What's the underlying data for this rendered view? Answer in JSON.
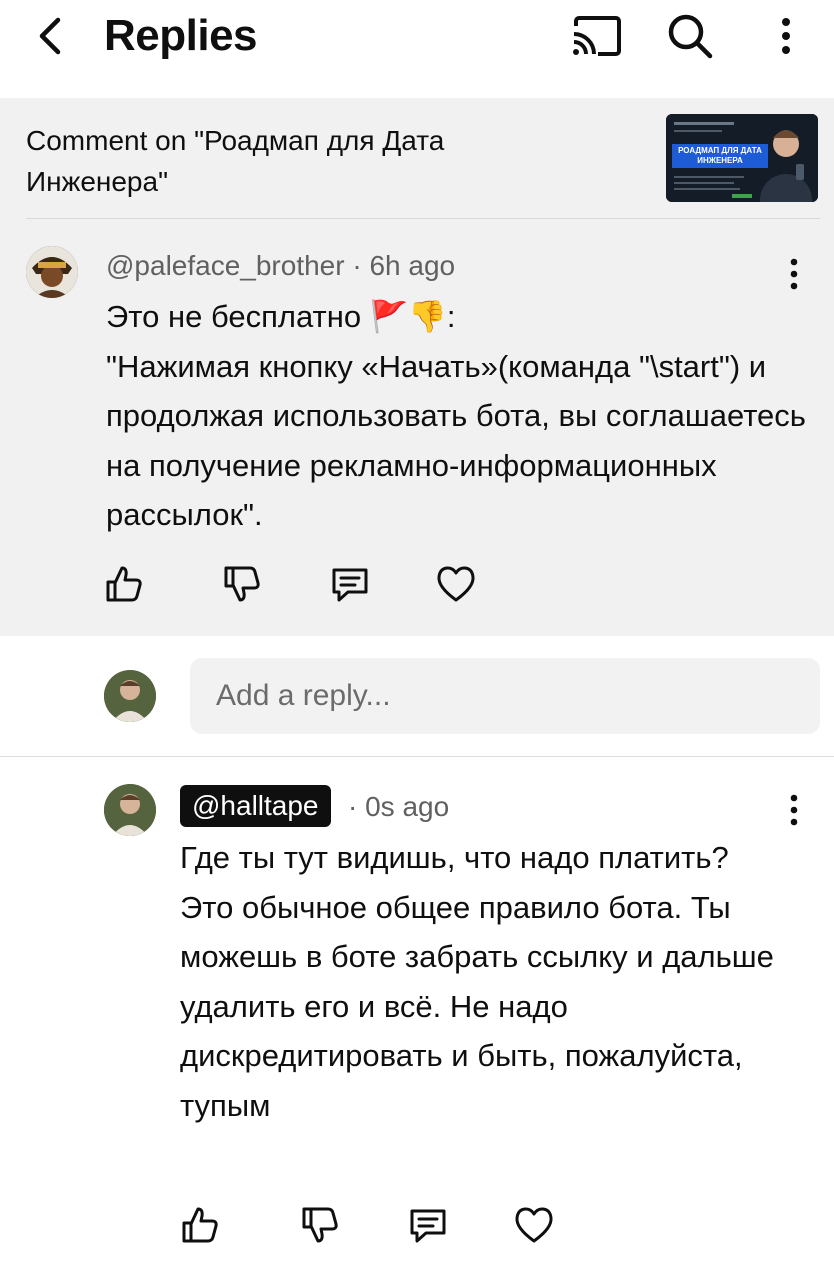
{
  "header": {
    "title": "Replies",
    "icons": [
      "back-arrow-icon",
      "cast-icon",
      "search-icon",
      "more-vert-icon"
    ]
  },
  "context": {
    "label": "Comment on \"Роадмап для Дата Инженера\"",
    "thumbnail_title": "РОАДМАП ДЛЯ ДАТА ИНЖЕНЕРА"
  },
  "comment": {
    "author": "@paleface_brother",
    "time": "6h ago",
    "text_line1": "Это не бесплатно 🚩👎:",
    "text_rest": "\"Нажимая кнопку «Начать»(команда \"\\start\") и продолжая использовать бота, вы соглашаетесь на получение рекламно-информационных рассылок\".",
    "actions": [
      "like-icon",
      "dislike-icon",
      "reply-icon",
      "heart-icon"
    ]
  },
  "reply_box": {
    "placeholder": "Add a reply..."
  },
  "reply": {
    "author": "@halltape",
    "time": "0s ago",
    "text": "Где ты тут видишь, что надо платить?\nЭто обычное общее правило бота. Ты можешь в боте забрать ссылку и дальше удалить его и всё. Не надо дискредитировать и быть, пожалуйста, тупым",
    "actions": [
      "like-icon",
      "dislike-icon",
      "reply-icon",
      "heart-icon"
    ]
  },
  "colors": {
    "panel_bg": "#f1f1f1",
    "text": "#0f0f0f",
    "meta": "#606060",
    "badge_bg": "#0f0f0f"
  }
}
